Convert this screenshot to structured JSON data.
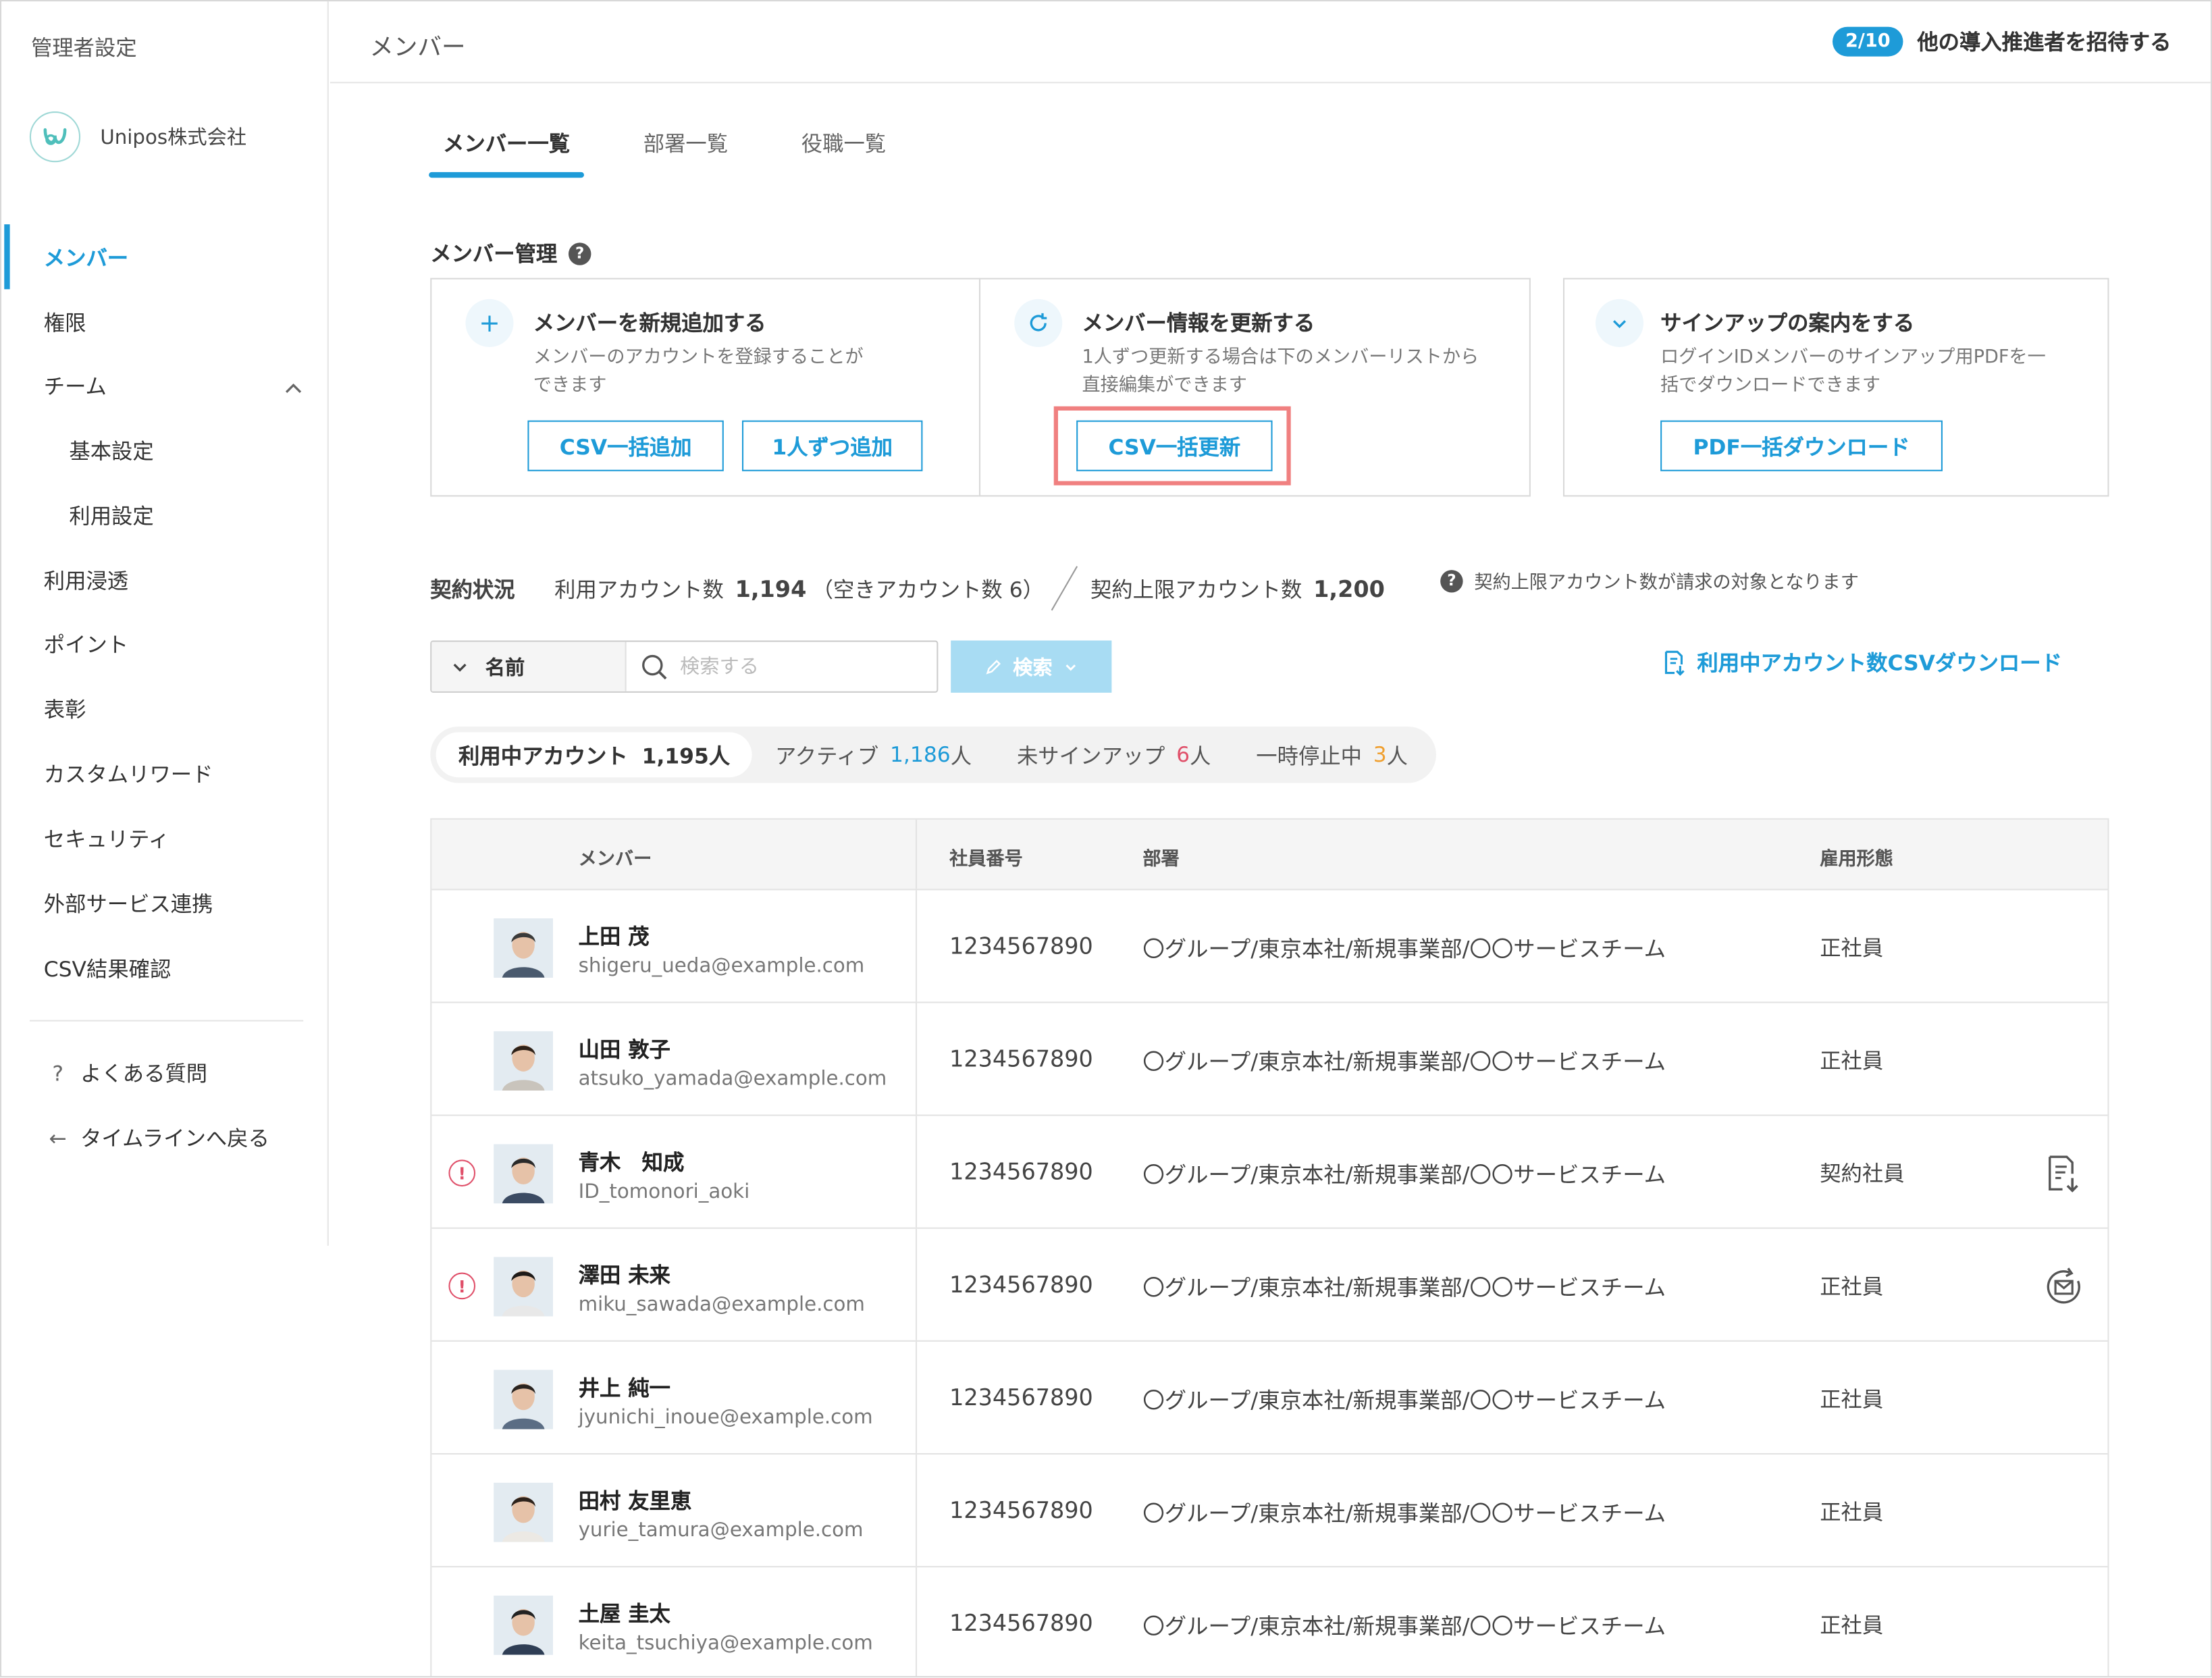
{
  "sidebar": {
    "title": "管理者設定",
    "org_name": "Unipos株式会社",
    "items": [
      {
        "label": "メンバー"
      },
      {
        "label": "権限"
      },
      {
        "label": "チーム"
      },
      {
        "label": "基本設定"
      },
      {
        "label": "利用設定"
      },
      {
        "label": "利用浸透"
      },
      {
        "label": "ポイント"
      },
      {
        "label": "表彰"
      },
      {
        "label": "カスタムリワード"
      },
      {
        "label": "セキュリティ"
      },
      {
        "label": "外部サービス連携"
      },
      {
        "label": "CSV結果確認"
      }
    ],
    "faq": "よくある質問",
    "back": "タイムラインへ戻る"
  },
  "header": {
    "title": "メンバー",
    "invite_count": "2/10",
    "invite_label": "他の導入推進者を招待する"
  },
  "tabs": [
    {
      "label": "メンバー一覧"
    },
    {
      "label": "部署一覧"
    },
    {
      "label": "役職一覧"
    }
  ],
  "management": {
    "label": "メンバー管理",
    "cards": [
      {
        "icon": "plus-icon",
        "title": "メンバーを新規追加する",
        "desc1": "メンバーのアカウントを登録することが",
        "desc2": "できます",
        "buttons": [
          "CSV一括追加",
          "1人ずつ追加"
        ]
      },
      {
        "icon": "refresh-icon",
        "title": "メンバー情報を更新する",
        "desc1": "1人ずつ更新する場合は下のメンバーリストから",
        "desc2": "直接編集ができます",
        "buttons": [
          "CSV一括更新"
        ]
      },
      {
        "icon": "check-icon",
        "title": "サインアップの案内をする",
        "desc1": "ログインIDメンバーのサインアップ用PDFを一",
        "desc2": "括でダウンロードできます",
        "buttons": [
          "PDF一括ダウンロード"
        ]
      }
    ]
  },
  "contract": {
    "label": "契約状況",
    "used_label": "利用アカウント数",
    "used_value": "1,194",
    "free_text": "（空きアカウント数 6）",
    "limit_label": "契約上限アカウント数",
    "limit_value": "1,200",
    "note": "契約上限アカウント数が請求の対象となります"
  },
  "search": {
    "field": "名前",
    "placeholder": "検索する",
    "button": "検索",
    "csv_download": "利用中アカウント数CSVダウンロード"
  },
  "filters": {
    "active_label": "利用中アカウント",
    "active_value": "1,195人",
    "f1_label": "アクティブ",
    "f1_num": "1,186",
    "f2_label": "未サインアップ",
    "f2_num": "6",
    "f3_label": "一時停止中",
    "f3_num": "3",
    "unit": "人"
  },
  "table": {
    "headers": [
      "メンバー",
      "社員番号",
      "部署",
      "雇用形態"
    ],
    "rows": [
      {
        "name": "上田 茂",
        "email": "shigeru_ueda@example.com",
        "emp": "1234567890",
        "dept": "〇グループ/東京本社/新規事業部/〇〇サービスチーム",
        "type": "正社員"
      },
      {
        "name": "山田 敦子",
        "email": "atsuko_yamada@example.com",
        "emp": "1234567890",
        "dept": "〇グループ/東京本社/新規事業部/〇〇サービスチーム",
        "type": "正社員"
      },
      {
        "name": "青木　知成",
        "email": "ID_tomonori_aoki",
        "emp": "1234567890",
        "dept": "〇グループ/東京本社/新規事業部/〇〇サービスチーム",
        "type": "契約社員"
      },
      {
        "name": "澤田 未来",
        "email": "miku_sawada@example.com",
        "emp": "1234567890",
        "dept": "〇グループ/東京本社/新規事業部/〇〇サービスチーム",
        "type": "正社員"
      },
      {
        "name": "井上 純一",
        "email": "jyunichi_inoue@example.com",
        "emp": "1234567890",
        "dept": "〇グループ/東京本社/新規事業部/〇〇サービスチーム",
        "type": "正社員"
      },
      {
        "name": "田村 友里恵",
        "email": "yurie_tamura@example.com",
        "emp": "1234567890",
        "dept": "〇グループ/東京本社/新規事業部/〇〇サービスチーム",
        "type": "正社員"
      },
      {
        "name": "土屋 圭太",
        "email": "keita_tsuchiya@example.com",
        "emp": "1234567890",
        "dept": "〇グループ/東京本社/新規事業部/〇〇サービスチーム",
        "type": "正社員"
      }
    ]
  },
  "colors": {
    "accent": "#1e9bd8",
    "alert": "#e0506a",
    "highlight": "#f08080"
  }
}
